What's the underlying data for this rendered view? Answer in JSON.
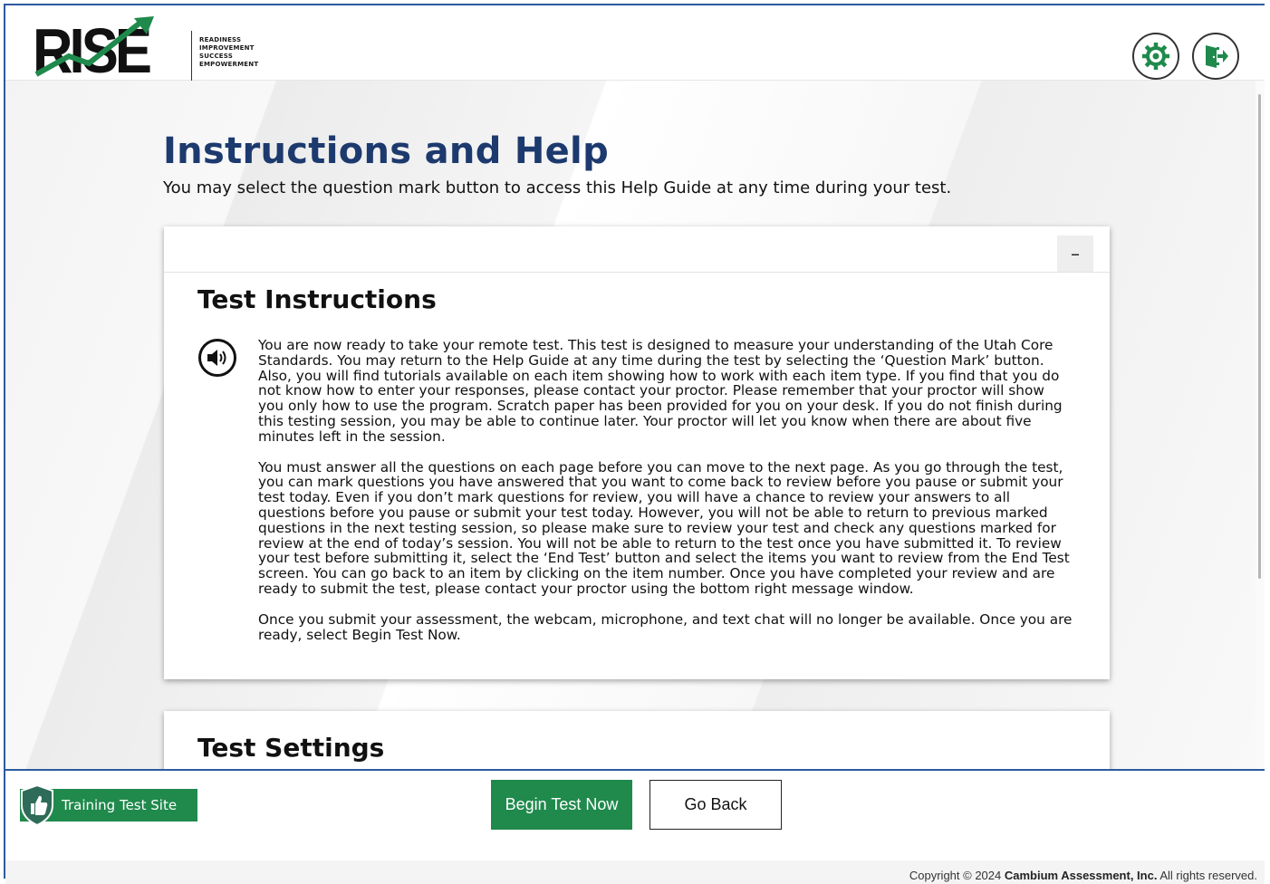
{
  "header": {
    "logo_text": "RISE",
    "logo_tagline": [
      "READINESS",
      "IMPROVEMENT",
      "SUCCESS",
      "EMPOWERMENT"
    ],
    "settings_icon": "gear-icon",
    "exit_icon": "exit-door-icon"
  },
  "page": {
    "title": "Instructions and Help",
    "subtitle": "You may select the question mark button to access this Help Guide at any time during your test."
  },
  "instructions_panel": {
    "collapse_label": "–",
    "heading": "Test Instructions",
    "speaker_icon": "speaker-icon",
    "paragraphs": [
      "You are now ready to take your remote test. This test is designed to measure your understanding of the Utah Core Standards. You may return to the Help Guide at any time during the test by selecting the ‘Question Mark’ button. Also, you will find tutorials available on each item showing how to work with each item type. If you find that you do not know how to enter your responses, please contact your proctor. Please remember that your proctor will show you only how to use the program. Scratch paper has been provided for you on your desk. If you do not finish during this testing session, you may be able to continue later. Your proctor will let you know when there are about five minutes left in the session.",
      "You must answer all the questions on each page before you can move to the next page. As you go through the test, you can mark questions you have answered that you want to come back to review before you pause or submit your test today. Even if you don’t mark questions for review, you will have a chance to review your answers to all questions before you pause or submit your test today. However, you will not be able to return to previous marked questions in the next testing session, so please make sure to review your test and check any questions marked for review at the end of today’s session. You will not be able to return to the test once you have submitted it. To review your test before submitting it, select the ‘End Test’ button and select the items you want to review from the End Test screen. You can go back to an item by clicking on the item number. Once you have completed your review and are ready to submit the test, please contact your proctor using the bottom right message window.",
      "Once you submit your assessment, the webcam, microphone, and text chat will no longer be available. Once you are ready, select Begin Test Now."
    ]
  },
  "settings_panel": {
    "heading": "Test Settings"
  },
  "footer": {
    "training_label": "Training Test Site",
    "begin_label": "Begin Test Now",
    "back_label": "Go Back",
    "copyright_prefix": "Copyright © 2024",
    "copyright_company": "Cambium Assessment, Inc.",
    "copyright_suffix": "All rights reserved."
  },
  "colors": {
    "brand_navy": "#1d3a6e",
    "button_green": "#1f8a4c",
    "frame_blue": "#2d5aa0"
  }
}
